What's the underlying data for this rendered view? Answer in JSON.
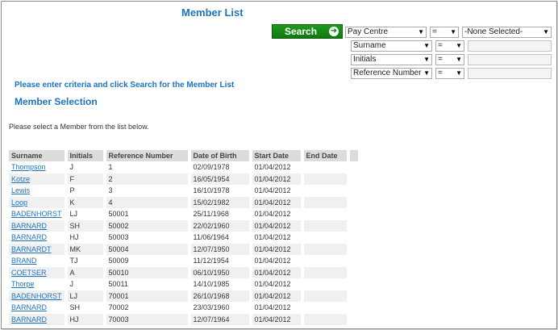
{
  "page": {
    "title": "Member List",
    "criteria_prompt": "Please enter criteria and click Search for the Member List",
    "section_title": "Member Selection",
    "instruction": "Please select a Member from the list below."
  },
  "search": {
    "button_label": "Search",
    "icon": "arrow-right-circle-icon",
    "rows": [
      {
        "field": "Pay Centre",
        "operator": "=",
        "value": "-None Selected-"
      },
      {
        "field": "Surname",
        "operator": "=",
        "value": ""
      },
      {
        "field": "Initials",
        "operator": "=",
        "value": ""
      },
      {
        "field": "Reference Number",
        "operator": "=",
        "value": ""
      }
    ]
  },
  "table": {
    "headers": [
      "Surname",
      "Initials",
      "Reference Number",
      "Date of Birth",
      "Start Date",
      "End Date",
      ""
    ],
    "rows": [
      [
        "Thompson",
        "J",
        "1",
        "02/09/1978",
        "01/04/2012",
        ""
      ],
      [
        "Kotze",
        "F",
        "2",
        "16/05/1954",
        "01/04/2012",
        ""
      ],
      [
        "Lewis",
        "P",
        "3",
        "16/10/1978",
        "01/04/2012",
        ""
      ],
      [
        "Loop",
        "K",
        "4",
        "15/02/1982",
        "01/04/2012",
        ""
      ],
      [
        "BADENHORST",
        "LJ",
        "50001",
        "25/11/1968",
        "01/04/2012",
        ""
      ],
      [
        "BARNARD",
        "SH",
        "50002",
        "22/02/1960",
        "01/04/2012",
        ""
      ],
      [
        "BARNARD",
        "HJ",
        "50003",
        "11/06/1964",
        "01/04/2012",
        ""
      ],
      [
        "BARNARDT",
        "MK",
        "50004",
        "12/07/1950",
        "01/04/2012",
        ""
      ],
      [
        "BRAND",
        "TJ",
        "50009",
        "11/12/1954",
        "01/04/2012",
        ""
      ],
      [
        "COETSER",
        "A",
        "50010",
        "06/10/1950",
        "01/04/2012",
        ""
      ],
      [
        "Thorpe",
        "J",
        "50011",
        "14/10/1985",
        "01/04/2012",
        ""
      ],
      [
        "BADENHORST",
        "LJ",
        "70001",
        "26/10/1968",
        "01/04/2012",
        ""
      ],
      [
        "BARNARD",
        "SH",
        "70002",
        "23/03/1960",
        "01/04/2012",
        ""
      ],
      [
        "BARNARD",
        "HJ",
        "70003",
        "12/07/1964",
        "01/04/2012",
        ""
      ]
    ]
  },
  "colors": {
    "accent": "#1e73be",
    "search_button": "#0d7a0d",
    "header_bg": "#dcdcdc",
    "row_alt": "#f0f0f0"
  }
}
